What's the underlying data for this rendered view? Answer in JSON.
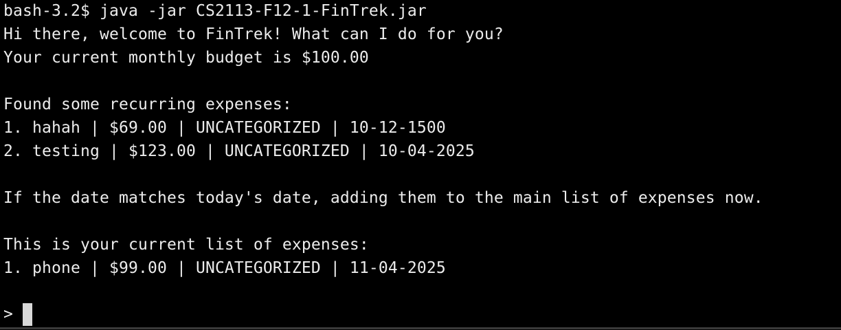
{
  "terminal": {
    "command_line": "bash-3.2$ java -jar CS2113-F12-1-FinTrek.jar",
    "welcome": "Hi there, welcome to FinTrek! What can I do for you?",
    "budget": "Your current monthly budget is $100.00",
    "recurring_header": "Found some recurring expenses:",
    "recurring_expenses": [
      "1. hahah | $69.00 | UNCATEGORIZED | 10-12-1500",
      "2. testing | $123.00 | UNCATEGORIZED | 10-04-2025"
    ],
    "date_note": "If the date matches today's date, adding them to the main list of expenses now.",
    "current_header": "This is your current list of expenses:",
    "current_expenses": [
      "1. phone | $99.00 | UNCATEGORIZED | 11-04-2025"
    ],
    "input_prompt": "> "
  },
  "colors": {
    "background": "#000000",
    "text": "#ececec",
    "cursor": "#d8d8d8"
  }
}
